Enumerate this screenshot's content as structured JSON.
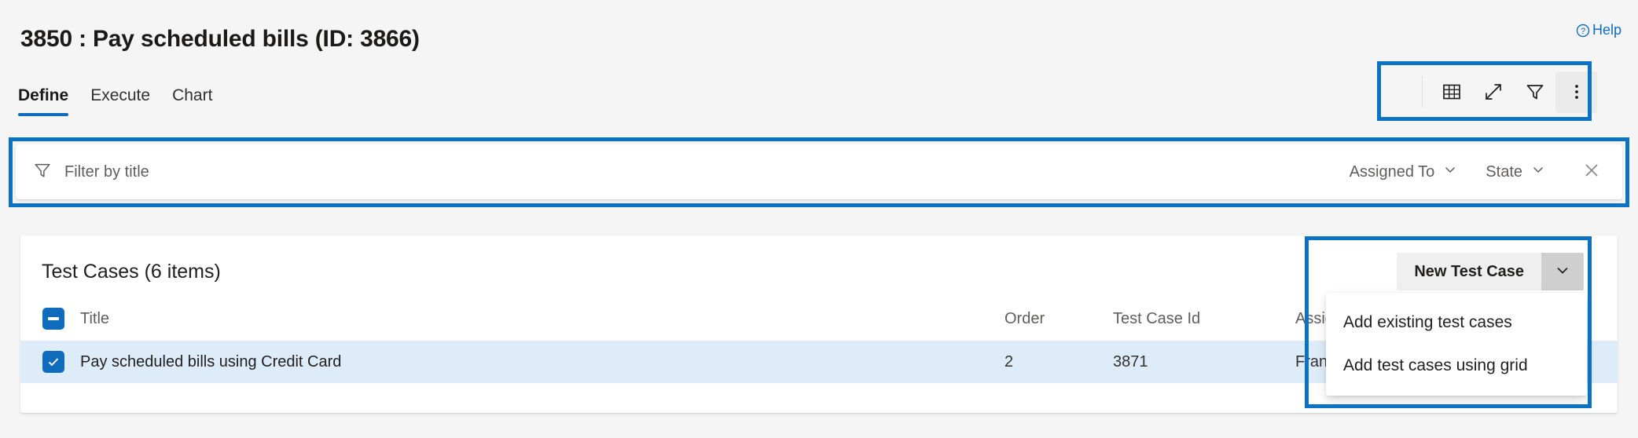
{
  "header": {
    "title": "3850 : Pay scheduled bills (ID: 3866)",
    "help_label": "Help",
    "help_icon": "question-circle-icon"
  },
  "tabs": [
    {
      "label": "Define",
      "active": true
    },
    {
      "label": "Execute",
      "active": false
    },
    {
      "label": "Chart",
      "active": false
    }
  ],
  "toolbar": {
    "buttons": [
      {
        "icon": "grid-icon",
        "active": false
      },
      {
        "icon": "expand-icon",
        "active": false
      },
      {
        "icon": "filter-icon",
        "active": false
      },
      {
        "icon": "more-options-icon",
        "active": true
      }
    ]
  },
  "filter_bar": {
    "icon": "filter-icon",
    "placeholder": "Filter by title",
    "value": "",
    "assigned_to_label": "Assigned To",
    "state_label": "State",
    "chevron_icon": "chevron-down-icon",
    "close_icon": "close-icon"
  },
  "card": {
    "title": "Test Cases (6 items)",
    "new_button_label": "New Test Case",
    "new_button_chevron": "chevron-down-icon",
    "columns": [
      "Title",
      "Order",
      "Test Case Id",
      "Assigned To"
    ],
    "header_checkbox_state": "indeterminate",
    "rows": [
      {
        "selected": true,
        "checkbox_state": "checked",
        "title": "Pay scheduled bills using Credit Card",
        "order": "2",
        "test_case_id": "3871",
        "assigned_to": "Franc"
      }
    ]
  },
  "menu": {
    "items": [
      "Add existing test cases",
      "Add test cases using grid"
    ]
  },
  "colors": {
    "accent": "#0f6cbd",
    "annotation": "#0b72c4",
    "row_selected": "#deecf9",
    "page_bg": "#f5f5f5"
  }
}
